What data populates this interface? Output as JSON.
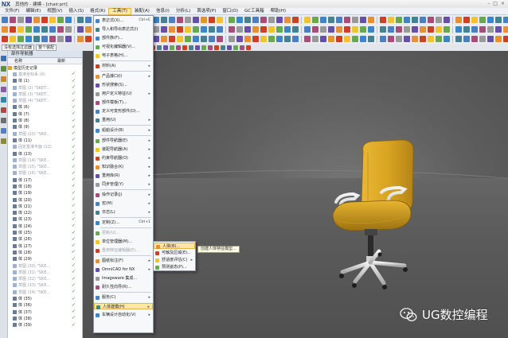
{
  "window": {
    "app_logo": "NX",
    "title": "其他的 - 建模 - [chair.prt]",
    "controls": [
      "–",
      "□",
      "×"
    ]
  },
  "menubar": {
    "items": [
      "文件(F)",
      "编辑(E)",
      "视图(V)",
      "插入(S)",
      "格式(R)",
      "工具(T)",
      "装配(A)",
      "信息(I)",
      "分析(L)",
      "首选项(P)",
      "窗口(O)",
      "GC工具箱",
      "帮助(H)"
    ],
    "active": "工具(T)"
  },
  "selection_bar": {
    "filter_value": "没有选择过滤器",
    "scope_value": "整个装配"
  },
  "part_navigator": {
    "title": "部件导航器",
    "col_name": "名称",
    "col_latest": "最新",
    "rows": [
      {
        "label": "模型历史记录",
        "check": "",
        "dim": false
      },
      {
        "label": "基准坐标系 (0)",
        "check": "✓",
        "dim": true
      },
      {
        "label": "体 (1)",
        "check": "✓",
        "dim": false
      },
      {
        "label": "草图 (2) \"SKET...",
        "check": "✓",
        "dim": true
      },
      {
        "label": "草图 (3) \"SKET...",
        "check": "✓",
        "dim": true
      },
      {
        "label": "草图 (4) \"SKET...",
        "check": "✓",
        "dim": true
      },
      {
        "label": "体 (6)",
        "check": "✓",
        "dim": false
      },
      {
        "label": "体 (7)",
        "check": "✓",
        "dim": false
      },
      {
        "label": "体 (8)",
        "check": "✓",
        "dim": false
      },
      {
        "label": "体 (9)",
        "check": "✓",
        "dim": false
      },
      {
        "label": "草图 (10) \"SKE...",
        "check": "✓",
        "dim": true
      },
      {
        "label": "体 (11)",
        "check": "✓",
        "dim": false
      },
      {
        "label": "固定基准平面 (12)",
        "check": "✓",
        "dim": true
      },
      {
        "label": "体 (13)",
        "check": "✓",
        "dim": false
      },
      {
        "label": "草图 (14) \"SKE...",
        "check": "✓",
        "dim": true
      },
      {
        "label": "草图 (15) \"SKE...",
        "check": "✓",
        "dim": true
      },
      {
        "label": "草图 (16) \"SKE...",
        "check": "✓",
        "dim": true
      },
      {
        "label": "体 (17)",
        "check": "✓",
        "dim": false
      },
      {
        "label": "体 (18)",
        "check": "✓",
        "dim": false
      },
      {
        "label": "体 (19)",
        "check": "✓",
        "dim": false
      },
      {
        "label": "体 (20)",
        "check": "✓",
        "dim": false
      },
      {
        "label": "体 (21)",
        "check": "✓",
        "dim": false
      },
      {
        "label": "体 (22)",
        "check": "✓",
        "dim": false
      },
      {
        "label": "体 (23)",
        "check": "✓",
        "dim": false
      },
      {
        "label": "体 (24)",
        "check": "✓",
        "dim": false
      },
      {
        "label": "体 (25)",
        "check": "✓",
        "dim": false
      },
      {
        "label": "体 (26)",
        "check": "✓",
        "dim": false
      },
      {
        "label": "体 (27)",
        "check": "✓",
        "dim": false
      },
      {
        "label": "体 (28)",
        "check": "✓",
        "dim": false
      },
      {
        "label": "体 (29)",
        "check": "✓",
        "dim": false
      },
      {
        "label": "草图 (30) \"SKE...",
        "check": "✓",
        "dim": true
      },
      {
        "label": "草图 (31) \"SKE...",
        "check": "✓",
        "dim": true
      },
      {
        "label": "草图 (32) \"SKE...",
        "check": "✓",
        "dim": true
      },
      {
        "label": "草图 (33) \"SKE...",
        "check": "✓",
        "dim": true
      },
      {
        "label": "草图 (34) \"SKE...",
        "check": "✓",
        "dim": true
      },
      {
        "label": "体 (35)",
        "check": "✓",
        "dim": false
      },
      {
        "label": "体 (36)",
        "check": "✓",
        "dim": false
      },
      {
        "label": "体 (37)",
        "check": "✓",
        "dim": false
      },
      {
        "label": "体 (38)",
        "check": "✓",
        "dim": false
      },
      {
        "label": "体 (39)",
        "check": "✓",
        "dim": false
      }
    ]
  },
  "tools_menu": {
    "items": [
      {
        "label": "表达式(X)...",
        "shortcut": "Ctrl+E",
        "arrow": false,
        "dim": false,
        "highlight": false
      },
      {
        "label": "导入和导出表达式(I)",
        "shortcut": "",
        "arrow": false,
        "dim": false,
        "highlight": false
      },
      {
        "label": "部件族(F)...",
        "shortcut": "",
        "arrow": false,
        "dim": false,
        "highlight": false
      },
      {
        "label": "可视化编辑器(V)...",
        "shortcut": "",
        "arrow": false,
        "dim": false,
        "highlight": false
      },
      {
        "label": "电子表格(H)...",
        "shortcut": "",
        "arrow": false,
        "dim": false,
        "highlight": false
      },
      {
        "label": "材料(A)",
        "shortcut": "",
        "arrow": true,
        "dim": false,
        "highlight": false
      },
      {
        "label": "产品接口(I)",
        "shortcut": "",
        "arrow": true,
        "dim": false,
        "highlight": false
      },
      {
        "label": "形状搜索(S)...",
        "shortcut": "",
        "arrow": false,
        "dim": false,
        "highlight": false
      },
      {
        "label": "用户定义特征(U)",
        "shortcut": "",
        "arrow": true,
        "dim": false,
        "highlight": false
      },
      {
        "label": "部件模板(T)...",
        "shortcut": "",
        "arrow": false,
        "dim": false,
        "highlight": false
      },
      {
        "label": "定义可变形部件(D)...",
        "shortcut": "",
        "arrow": false,
        "dim": false,
        "highlight": false
      },
      {
        "label": "重用(U)",
        "shortcut": "",
        "arrow": true,
        "dim": false,
        "highlight": false
      },
      {
        "label": "船舶设计(B)",
        "shortcut": "",
        "arrow": true,
        "dim": false,
        "highlight": false
      },
      {
        "label": "部件导航器(E)",
        "shortcut": "",
        "arrow": true,
        "dim": false,
        "highlight": false
      },
      {
        "label": "装配导航器(A)",
        "shortcut": "",
        "arrow": true,
        "dim": false,
        "highlight": false
      },
      {
        "label": "约束导航器(O)",
        "shortcut": "",
        "arrow": true,
        "dim": false,
        "highlight": false
      },
      {
        "label": "知识融合(K)",
        "shortcut": "",
        "arrow": true,
        "dim": false,
        "highlight": false
      },
      {
        "label": "重用库(R)",
        "shortcut": "",
        "arrow": true,
        "dim": false,
        "highlight": false
      },
      {
        "label": "同步管理(Y)",
        "shortcut": "",
        "arrow": true,
        "dim": false,
        "highlight": false
      },
      {
        "label": "操作记录(J)",
        "shortcut": "",
        "arrow": true,
        "dim": false,
        "highlight": false
      },
      {
        "label": "宏(M)",
        "shortcut": "",
        "arrow": true,
        "dim": false,
        "highlight": false
      },
      {
        "label": "日志(L)",
        "shortcut": "",
        "arrow": true,
        "dim": false,
        "highlight": false
      },
      {
        "label": "定制(Z)...",
        "shortcut": "Ctrl+1",
        "arrow": false,
        "dim": false,
        "highlight": false
      },
      {
        "label": "更新(U)...",
        "shortcut": "",
        "arrow": false,
        "dim": true,
        "highlight": false
      },
      {
        "label": "单位管理器(M)...",
        "shortcut": "",
        "arrow": false,
        "dim": false,
        "highlight": false
      },
      {
        "label": "重用特征编辑器(E)...",
        "shortcut": "",
        "arrow": false,
        "dim": true,
        "highlight": false
      },
      {
        "label": "图纸标注(F)",
        "shortcut": "",
        "arrow": true,
        "dim": false,
        "highlight": false
      },
      {
        "label": "OmniCAD for NX",
        "shortcut": "",
        "arrow": true,
        "dim": false,
        "highlight": false
      },
      {
        "label": "Imageware 集成...",
        "shortcut": "",
        "arrow": false,
        "dim": false,
        "highlight": false
      },
      {
        "label": "耐久性向导(R)...",
        "shortcut": "",
        "arrow": false,
        "dim": false,
        "highlight": false
      },
      {
        "label": "服务(C)",
        "shortcut": "",
        "arrow": true,
        "dim": false,
        "highlight": false
      },
      {
        "label": "人体建模(H)",
        "shortcut": "",
        "arrow": true,
        "dim": false,
        "highlight": true
      },
      {
        "label": "车辆设计自动化(V)",
        "shortcut": "",
        "arrow": true,
        "dim": false,
        "highlight": false
      }
    ]
  },
  "human_modeling_submenu": {
    "items": [
      {
        "label": "人体(B)...",
        "arrow": false,
        "highlight": true
      },
      {
        "label": "可触及区域(E)...",
        "arrow": false,
        "highlight": false
      },
      {
        "label": "舒适度评估(C)",
        "arrow": true,
        "highlight": false
      },
      {
        "label": "预测姿态(P)...",
        "arrow": false,
        "highlight": false
      }
    ]
  },
  "tooltip": {
    "text": "创建人体特征模型..."
  },
  "watermark": {
    "text": "UG数控编程"
  },
  "colors": {
    "chair_seat": "#d9a521",
    "chair_seat_shadow": "#9c7210",
    "chair_frame": "#d8d8d8",
    "chair_column": "#2a2a2a",
    "menu_highlight": "#ffe7a4",
    "viewport_bg": "#5e5e5e"
  }
}
